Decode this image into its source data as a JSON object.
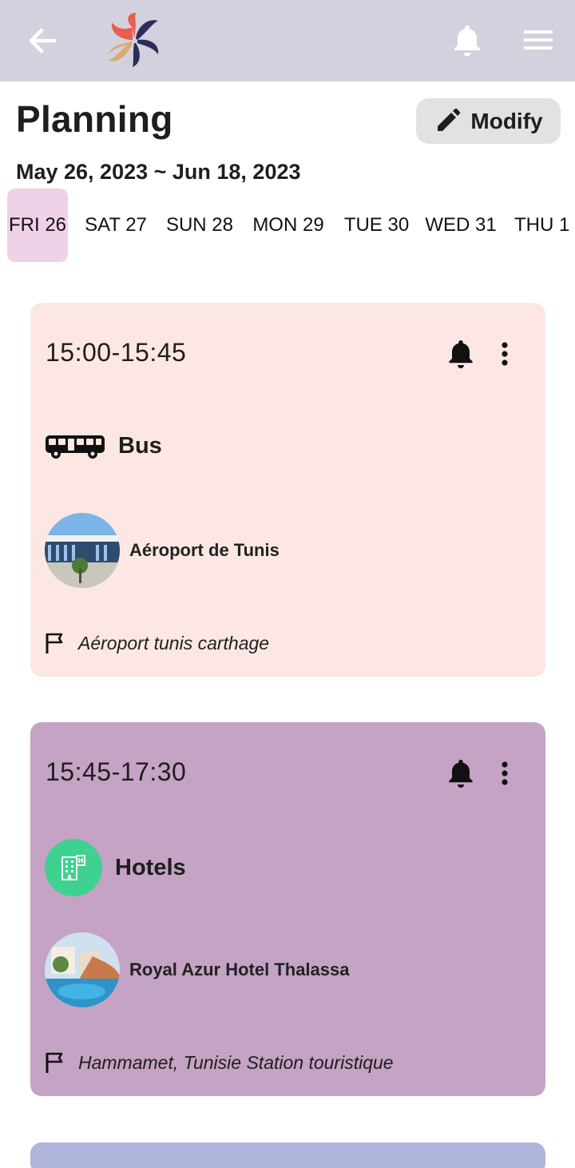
{
  "header": {
    "back_icon": "arrow-left-icon",
    "logo": "app-logo",
    "notification_icon": "bell-icon",
    "menu_icon": "hamburger-menu-icon",
    "background": "#d2d1dd"
  },
  "page": {
    "title": "Planning",
    "modify_label": "Modify",
    "date_range": "May 26, 2023 ~ Jun 18, 2023"
  },
  "days": [
    {
      "label": "FRI 26",
      "active": true
    },
    {
      "label": "SAT 27",
      "active": false
    },
    {
      "label": "SUN 28",
      "active": false
    },
    {
      "label": "MON 29",
      "active": false
    },
    {
      "label": "TUE 30",
      "active": false
    },
    {
      "label": "WED 31",
      "active": false
    },
    {
      "label": "THU 1",
      "active": false
    }
  ],
  "events": [
    {
      "time": "15:00-15:45",
      "type": "Bus",
      "type_icon": "bus-icon",
      "place": "Aéroport de Tunis",
      "address": "Aéroport tunis carthage",
      "color": "#fce7e4"
    },
    {
      "time": "15:45-17:30",
      "type": "Hotels",
      "type_icon": "hotel-icon",
      "place": "Royal Azur Hotel Thalassa",
      "address": "Hammamet, Tunisie Station touristique",
      "color": "#c4a3c4"
    }
  ],
  "colors": {
    "active_day": "#efd1e8",
    "hotel_badge": "#3ed190",
    "third_card": "#b0b5dc"
  }
}
